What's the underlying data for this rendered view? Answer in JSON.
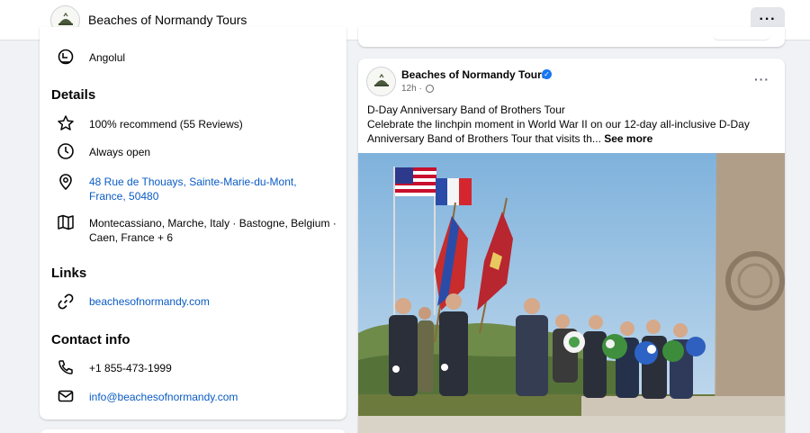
{
  "header": {
    "page_name": "Beaches of Normandy Tours",
    "more_label": "···"
  },
  "intro": {
    "category": "Angolul",
    "details_heading": "Details",
    "recommend": "100% recommend (55 Reviews)",
    "hours": "Always open",
    "address_line1": "48 Rue de Thouays, Sainte-Marie-du-Mont,",
    "address_line2": "France, 50480",
    "locations_line1": "Montecassiano, Marche, Italy · Bastogne, Belgium ·",
    "locations_line2": "Caen, France + 6",
    "links_heading": "Links",
    "website": "beachesofnormandy.com",
    "contact_heading": "Contact info",
    "phone": "+1 855-473-1999",
    "email": "info@beachesofnormandy.com"
  },
  "post": {
    "author": "Beaches of Normandy Tours",
    "verified_mark": "✓",
    "time": "12h ·",
    "menu_label": "···",
    "line1": "D-Day Anniversary Band of Brothers Tour",
    "line2": "Celebrate the linchpin moment in World War II on our 12-day all-inclusive D-Day",
    "line3": "Anniversary Band of Brothers Tour that visits th...",
    "see_more": "See more"
  },
  "colors": {
    "link": "#0a5bc4",
    "verified": "#1877f2",
    "background": "#f0f2f5"
  }
}
